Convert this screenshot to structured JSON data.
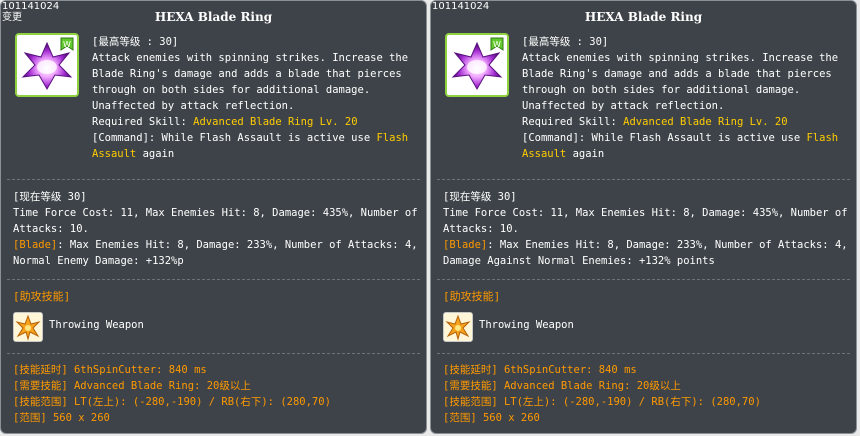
{
  "panels": [
    {
      "id": "101141024",
      "tag": "变更",
      "title": "HEXA Blade Ring",
      "icon": "hexa-blade-ring-icon",
      "max_level": "[最高等级 : 30]",
      "desc": [
        "Attack enemies with spinning strikes. Increase the",
        "Blade Ring's damage and adds a blade that pierces",
        "through on both sides for additional damage.",
        "Unaffected by attack reflection."
      ],
      "required_prefix": "Required Skill: ",
      "required_value": "Advanced Blade Ring Lv. 20",
      "command_prefix": "[Command]: While Flash Assault is active use ",
      "command_value_1": "Flash",
      "command_value_2": "Assault",
      "command_suffix": " again",
      "current_level": "[现在等级 30]",
      "level_lines": [
        "Time Force Cost: 11, Max Enemies Hit: 8, Damage: 435%, Number of",
        "Attacks: 10."
      ],
      "blade_tag": "[Blade]",
      "blade_lines": [
        ": Max Enemies Hit: 8, Damage: 233%, Number of Attacks: 4,",
        "Normal Enemy Damage: +132%p"
      ],
      "assist_title": "[助攻技能]",
      "assist_name": "Throwing Weapon",
      "assist_icon": "throwing-weapon-icon",
      "info_lines": [
        "[技能延时] 6thSpinCutter: 840 ms",
        "[需要技能] Advanced Blade Ring: 20级以上",
        "[技能范围] LT(左上): (-280,-190) / RB(右下): (280,70)",
        "[范围] 560 x 260"
      ]
    },
    {
      "id": "101141024",
      "tag": "",
      "title": "HEXA Blade Ring",
      "icon": "hexa-blade-ring-icon",
      "max_level": "[最高等级 : 30]",
      "desc": [
        "Attack enemies with spinning strikes. Increase the",
        "Blade Ring's damage and adds a blade that pierces",
        "through on both sides for additional damage.",
        "Unaffected by attack reflection."
      ],
      "required_prefix": "Required Skill: ",
      "required_value": "Advanced Blade Ring Lv. 20",
      "command_prefix": "[Command]: While Flash Assault is active use ",
      "command_value_1": "Flash",
      "command_value_2": "Assault",
      "command_suffix": " again",
      "current_level": "[现在等级 30]",
      "level_lines": [
        "Time Force Cost: 11, Max Enemies Hit: 8, Damage: 435%, Number of",
        "Attacks: 10."
      ],
      "blade_tag": "[Blade]",
      "blade_lines": [
        ": Max Enemies Hit: 8, Damage: 233%, Number of Attacks: 4,",
        "Damage Against Normal Enemies: +132% points"
      ],
      "assist_title": "[助攻技能]",
      "assist_name": "Throwing Weapon",
      "assist_icon": "throwing-weapon-icon",
      "info_lines": [
        "[技能延时] 6thSpinCutter: 840 ms",
        "[需要技能] Advanced Blade Ring: 20级以上",
        "[技能范围] LT(左上): (-280,-190) / RB(右下): (280,70)",
        "[范围] 560 x 260"
      ]
    }
  ],
  "colors": {
    "panel_bg": "#3d4348",
    "highlight_yellow": "#ffcc00",
    "section_orange": "#ff9900",
    "icon_border_green": "#8fd13f"
  }
}
